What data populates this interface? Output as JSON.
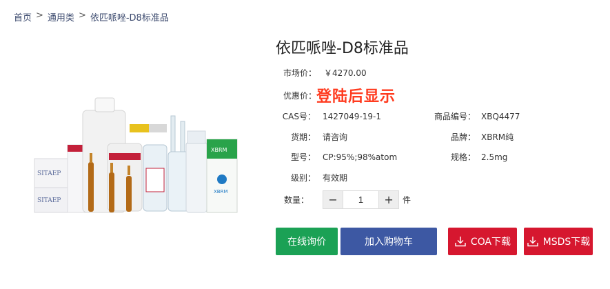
{
  "breadcrumb": {
    "home": "首页",
    "category": "通用类",
    "current": "依匹哌唑-D8标准品",
    "separator": ">"
  },
  "product": {
    "title": "依匹哌唑-D8标准品",
    "market_price_label": "市场价：",
    "market_price": "￥4270.00",
    "discount_label": "优惠价：",
    "discount_value": "登陆后显示",
    "cas_label": "CAS号：",
    "cas_value": "1427049-19-1",
    "code_label": "商品编号：",
    "code_value": "XBQ4477",
    "delivery_label": "货期：",
    "delivery_value": "请咨询",
    "brand_label": "品牌：",
    "brand_value": "XBRM纯",
    "model_label": "型号：",
    "model_value": "CP:95%;98%atom",
    "spec_label": "规格：",
    "spec_value": "2.5mg",
    "grade_label": "级别：",
    "grade_value": "有效期"
  },
  "quantity": {
    "label": "数量：",
    "minus": "−",
    "value": "1",
    "plus": "+",
    "unit": "件"
  },
  "buttons": {
    "inquiry": "在线询价",
    "cart": "加入购物车",
    "coa": "COA下载",
    "msds": "MSDS下载"
  },
  "image_labels": {
    "brand_box": "SITAEP",
    "bottle_brand": "XBRM"
  },
  "colors": {
    "green": "#1ba155",
    "blue": "#3d58a3",
    "red": "#d6172f",
    "discount": "#ff3b1f"
  }
}
